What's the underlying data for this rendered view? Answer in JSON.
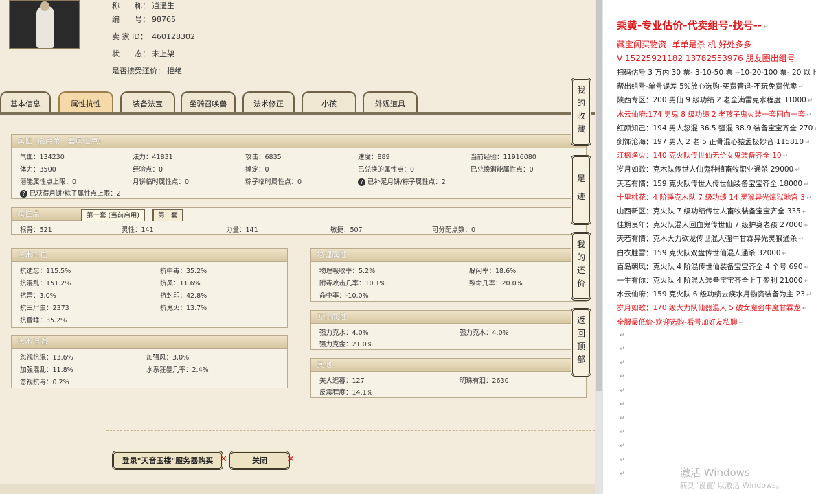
{
  "profile": {
    "name_k": "称　　称：",
    "name_v": "逍遥生",
    "code_k": "编　　号：",
    "code_v": "98765",
    "seller_k": "卖 家  ID：",
    "seller_v": "460128302",
    "status_k": "状　　态：",
    "status_v": "未上架",
    "bargain_k": "是否接受还价：",
    "bargain_v": "拒绝"
  },
  "tabs": [
    "基本信息",
    "属性抗性",
    "装备法宝",
    "坐骑召唤兽",
    "法术修正",
    "小孩",
    "外观道具"
  ],
  "active_tab": "属性抗性",
  "attr": {
    "header": "属性 (启用第一套属性点)",
    "cells": [
      "气血：134230",
      "法力：41831",
      "攻击：6835",
      "速度：889",
      "当前经验：11916080",
      "体力：3500",
      "经验点：0",
      "掉定：0",
      "已兑换的属性点：0",
      "已兑换潜能属性点：0",
      "潜能属性点上限：0",
      "月饼临时属性点：0",
      "粽子临时属性点：0",
      "已补足月饼/粽子属性点：2",
      "已获得月饼/粽子属性点上限：2"
    ]
  },
  "points": {
    "header": "属性点",
    "subtab1": "第一套 (当前启用)",
    "subtab2": "第二套",
    "cells": [
      "根骨：521",
      "灵性：141",
      "力量：141",
      "敏捷：507",
      "可分配点数：0"
    ]
  },
  "resist": {
    "header": "法术抗性",
    "cells": [
      "抗遗忘：115.5%",
      "抗中毒：35.2%",
      "抗混乱：151.2%",
      "抗风：11.6%",
      "抗雷：3.0%",
      "抗封印：42.8%",
      "抗三尸虫：2373",
      "抗鬼火：13.7%",
      "抗昏睡：35.2%"
    ]
  },
  "boost": {
    "header": "法术增强",
    "cells": [
      "忽视抗混：13.6%",
      "加强风：3.0%",
      "加强混乱：11.8%",
      "水系狂暴几率：2.4%",
      "忽视抗毒：0.2%"
    ]
  },
  "physical": {
    "header": "物理属性",
    "cells": [
      "物理吸收率：5.2%",
      "躲闪率：18.6%",
      "附毒攻击几率：10.1%",
      "致命几率：20.0%",
      "命中率：-10.0%"
    ]
  },
  "five": {
    "header": "五行属性",
    "cells": [
      "强力克水：4.0%",
      "强力克木：4.0%",
      "强力克金：21.0%"
    ]
  },
  "other": {
    "header": "其他",
    "cells": [
      "美人迟暮：127",
      "明珠有泪：2630",
      "反震程度：14.1%"
    ]
  },
  "buttons": {
    "login": "登录\"天音玉楼\"服务器购买",
    "close": "关闭"
  },
  "side_tabs": [
    "我的收藏",
    "足迹",
    "我的还价",
    "返回顶部"
  ],
  "right_panel": {
    "title": "乘黄-专业估价-代卖组号-找号--",
    "line1": "藏宝阁买物资--单单是杀 机 好处多多",
    "line2": "V 15225921182    13782553976 朋友圈出组号",
    "lines": [
      {
        "t": "扫码估号 3 万内 30 票- 3-10-50 票  --10-20-100 票- 20 以上",
        "red": false
      },
      {
        "t": "帮出组号-单号误差 5%放心选购-买费管退-不玩免费代卖",
        "red": false
      },
      {
        "t": "陕西专区：200 男仙 9 级功绩 2 老全满雷克水程度 31000",
        "red": false
      },
      {
        "t": "水云仙府:174 男鬼 8 级功绩 2 老孩子鬼火装一套回血一套",
        "red": true
      },
      {
        "t": "红颜知己：194 男人忽混 36.5 强混 38.9 装备宝宝齐全 270",
        "red": false
      },
      {
        "t": "剑饰沧海：197 男人 2 老 5 正骨混心猿孟极妙音 115810",
        "red": false
      },
      {
        "t": "江枫渔火：140 克火队传世仙无价女鬼装备齐全 10",
        "red": true
      },
      {
        "t": "岁月如歌：克木队传世人仙鬼种植畜牧职业通杀 29000",
        "red": false
      },
      {
        "t": "天若有情：159 克火队传世人传世仙装备宝宝齐全 18000",
        "red": false
      },
      {
        "t": "十里桃花：4 阶睡克木队 7 级功绩 14 灵猴异光炼狱地宫 3",
        "red": true
      },
      {
        "t": "山西新区：克火队 7 级功绩传世人畜牧装备宝宝齐全 335",
        "red": false
      },
      {
        "t": "佳期良年：克火队混人回血鬼传世仙 7 级护身老孩 27000",
        "red": false
      },
      {
        "t": "天若有情：克木大力砍龙传世混人强牛甘霖异光灵猴通杀",
        "red": false
      },
      {
        "t": "白衣胜雪：159 克火队双盘传世仙混人通杀 32000",
        "red": false
      },
      {
        "t": "百岛朝风：克火队 4 阶混传世仙装备宝宝齐全 4 个号 690",
        "red": false
      },
      {
        "t": "一生有你：克火队 4 阶混人装备宝宝齐全上手盈利 21000",
        "red": false
      },
      {
        "t": "水云仙府：159 克火队 6 级功绩去疾水月物资装备为主 23",
        "red": false
      },
      {
        "t": "岁月如歌：170 级大力队仙器混人 5 破女魔强牛魔甘霖龙",
        "red": true
      },
      {
        "t": "全服最低价-欢迎选购-看号加好友私聊",
        "red": true
      }
    ],
    "para_mark": "↵"
  },
  "watermark": {
    "line1": "激活 Windows",
    "line2": "转到\"设置\"以激活 Windows。"
  }
}
